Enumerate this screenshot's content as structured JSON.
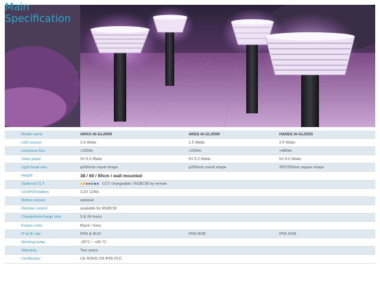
{
  "title": {
    "line1": "Main",
    "line2": "Specification"
  },
  "colors": {
    "accent": "#2aa7c9",
    "row_stripe": "#dde8f0",
    "glow": "#c36be0"
  },
  "table": {
    "headers": [
      "Model name",
      "ARKO AI-GL260R",
      "ARES AI-GL255R",
      "HADES AI-GL255S"
    ],
    "rows": [
      [
        "LED source",
        "1.5 Watts",
        "1.5 Watts",
        "2.5 Watts"
      ],
      [
        "Luminous flux",
        ">220lm",
        ">220lm",
        ">480lm"
      ],
      [
        "Solar panel",
        "5V 6.2 Watts",
        "5V 6.2 Watts",
        "5V 9.2 Watts"
      ],
      [
        "Light head size",
        "φ260mm round shape",
        "φ255mm round shape",
        "255*255mm square shape"
      ],
      [
        "Height",
        "38 / 60 / 90cm / wall mounted",
        "",
        ""
      ],
      [
        "Optional CCT",
        "CCT changeable / RGBCW by remote",
        "",
        ""
      ],
      [
        "LiFePO4 battery",
        "3.2V 12AH",
        "",
        ""
      ],
      [
        "Motion sensor",
        "optional",
        "",
        ""
      ],
      [
        "Remote control",
        "available for RGBCW",
        "",
        ""
      ],
      [
        "Charge&discharge time",
        "5 & 24 hours",
        "",
        ""
      ],
      [
        "Fixture color",
        "Black / Grey",
        "",
        ""
      ],
      [
        "IP & IK rate",
        "IP65 & IK10",
        "IP65 IK08",
        "IP65 IK08"
      ],
      [
        "Working temp.",
        "-20°C ~ +65 °C",
        "",
        ""
      ],
      [
        "Warranty",
        "Two years",
        "",
        ""
      ],
      [
        "Certificates",
        "CE ROHS CB IP65 FCC",
        "",
        ""
      ]
    ],
    "cct_dot_colors": [
      "#f2c94c",
      "#f0a030",
      "#888888",
      "#e03c3c",
      "#3cb04a",
      "#3c6de0",
      "#b04ad0"
    ]
  }
}
